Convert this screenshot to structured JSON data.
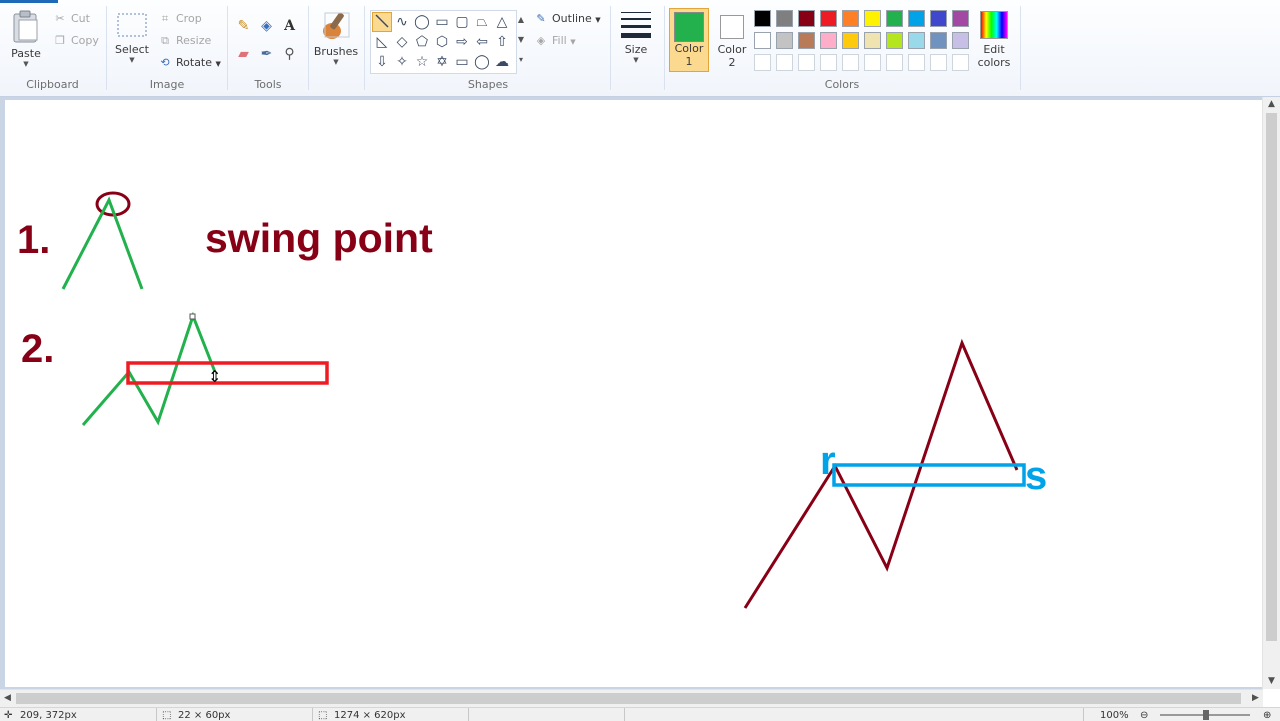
{
  "ribbon": {
    "clipboard": {
      "group_label": "Clipboard",
      "paste": "Paste",
      "cut": "Cut",
      "copy": "Copy"
    },
    "image": {
      "group_label": "Image",
      "select": "Select",
      "crop": "Crop",
      "resize": "Resize",
      "rotate": "Rotate"
    },
    "tools": {
      "group_label": "Tools",
      "icons": [
        "pencil-icon",
        "fill-bucket-icon",
        "text-icon",
        "eraser-icon",
        "color-picker-icon",
        "magnifier-icon"
      ]
    },
    "brushes": {
      "label": "Brushes"
    },
    "shapes": {
      "group_label": "Shapes",
      "outline": "Outline",
      "fill": "Fill",
      "selected_shape": "line"
    },
    "size": {
      "label": "Size"
    },
    "colors": {
      "group_label": "Colors",
      "color1_label": "Color",
      "color1_num": "1",
      "color2_label": "Color",
      "color2_num": "2",
      "edit_label": "Edit",
      "edit_label2": "colors",
      "color1": "#22b14c",
      "color2": "#ffffff",
      "palette_row1": [
        "#000000",
        "#7f7f7f",
        "#880015",
        "#ed1c24",
        "#ff7f27",
        "#fff200",
        "#22b14c",
        "#00a2e8",
        "#3f48cc",
        "#a349a4"
      ],
      "palette_row2": [
        "#ffffff",
        "#c3c3c3",
        "#b97a57",
        "#ffaec9",
        "#ffc90e",
        "#efe4b0",
        "#b5e61d",
        "#99d9ea",
        "#7092be",
        "#c8bfe7"
      ]
    }
  },
  "canvas": {
    "label_1": "1.",
    "label_2": "2.",
    "swing_text": "swing point",
    "letter_r": "r",
    "letter_s": "s",
    "colors": {
      "dark_red": "#880015",
      "green": "#22b14c",
      "red": "#ed1c24",
      "blue": "#00a2e8"
    }
  },
  "status": {
    "cursor_pos": "209, 372px",
    "selection_size": "22 × 60px",
    "image_size": "1274 × 620px",
    "zoom": "100%"
  }
}
